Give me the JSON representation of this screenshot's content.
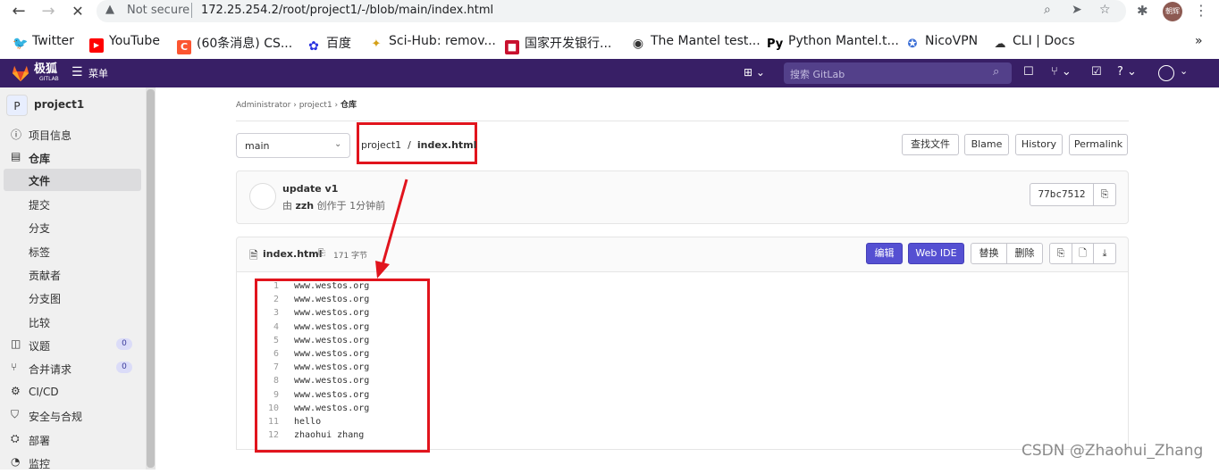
{
  "browser": {
    "not_secure": "Not secure",
    "url": "172.25.254.2/root/project1/-/blob/main/index.html",
    "profile_label": "朝辉",
    "bookmarks": [
      {
        "label": "Twitter",
        "color": "#1d9bf0"
      },
      {
        "label": "YouTube",
        "color": "#ff0000"
      },
      {
        "label": "(60条消息) CS...",
        "color": "#fc5531"
      },
      {
        "label": "百度",
        "color": "#2932e1"
      },
      {
        "label": "Sci-Hub: remov...",
        "color": "#d4a017"
      },
      {
        "label": "国家开发银行...",
        "color": "#c8102e"
      },
      {
        "label": "The Mantel test...",
        "color": "#333333"
      },
      {
        "label": "Python Mantel.t...",
        "color": "#000000"
      },
      {
        "label": "NicoVPN",
        "color": "#3b6fd6"
      },
      {
        "label": "CLI | Docs",
        "color": "#333333"
      }
    ],
    "bookmarks_more": "»"
  },
  "gitlab": {
    "brand": "极狐",
    "brand_sub": "GITLAB",
    "menu_label": "菜单",
    "search_placeholder": "搜索 GitLab",
    "header_color": "#381f66"
  },
  "sidebar": {
    "project_initial": "P",
    "project_name": "project1",
    "items": [
      {
        "label": "项目信息",
        "icon": "info-icon"
      },
      {
        "label": "仓库",
        "icon": "document-icon"
      },
      {
        "label": "议题",
        "icon": "issues-icon",
        "badge": "0"
      },
      {
        "label": "合并请求",
        "icon": "merge-request-icon",
        "badge": "0"
      },
      {
        "label": "CI/CD",
        "icon": "rocket-icon"
      },
      {
        "label": "安全与合规",
        "icon": "shield-icon"
      },
      {
        "label": "部署",
        "icon": "deploy-icon"
      },
      {
        "label": "监控",
        "icon": "monitor-icon"
      }
    ],
    "sub_items": [
      "文件",
      "提交",
      "分支",
      "标签",
      "贡献者",
      "分支图",
      "比较"
    ]
  },
  "breadcrumb": [
    "Administrator",
    "project1",
    "仓库"
  ],
  "repo": {
    "branch": "main",
    "path_project": "project1",
    "path_file": "index.html",
    "buttons": {
      "find_file": "查找文件",
      "blame": "Blame",
      "history": "History",
      "permalink": "Permalink"
    }
  },
  "commit": {
    "title": "update v1",
    "meta_prefix": "由",
    "author": "zzh",
    "meta_suffix": "创作于 1分钟前",
    "sha": "77bc7512"
  },
  "file": {
    "name": "index.html",
    "size": "171 字节",
    "buttons": {
      "edit": "编辑",
      "web_ide": "Web IDE",
      "replace": "替换",
      "delete": "删除"
    },
    "lines": [
      "www.westos.org",
      "www.westos.org",
      "www.westos.org",
      "www.westos.org",
      "www.westos.org",
      "www.westos.org",
      "www.westos.org",
      "www.westos.org",
      "www.westos.org",
      "www.westos.org",
      "hello",
      "zhaohui zhang"
    ]
  },
  "watermark": "CSDN @Zhaohui_Zhang"
}
